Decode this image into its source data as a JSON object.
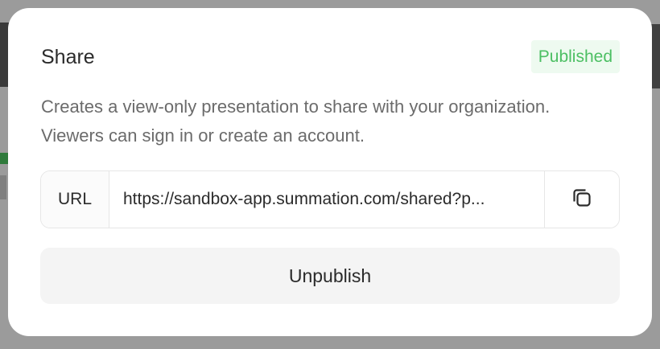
{
  "modal": {
    "title": "Share",
    "status": "Published",
    "description": "Creates a view-only presentation to share with your organization. Viewers can sign in or create an account.",
    "url_label": "URL",
    "url_value": "https://sandbox-app.summation.com/shared?p...",
    "copy_icon": "copy-icon",
    "unpublish_label": "Unpublish"
  },
  "colors": {
    "status_text": "#4cbf63",
    "status_bg": "#eefaf0",
    "overlay": "#9b9b9b"
  }
}
